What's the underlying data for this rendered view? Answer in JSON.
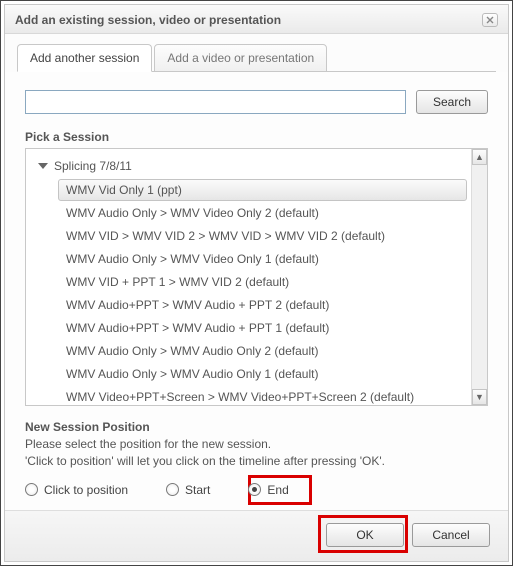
{
  "dialog": {
    "title": "Add an existing session, video or presentation"
  },
  "tabs": {
    "active": "Add another session",
    "other": "Add a video or presentation"
  },
  "search": {
    "value": "",
    "placeholder": "",
    "button": "Search"
  },
  "pick": {
    "title": "Pick a Session",
    "parent": "Splicing 7/8/11",
    "items": [
      "WMV Vid Only 1 (ppt)",
      "WMV Audio Only > WMV Video Only 2 (default)",
      "WMV VID > WMV VID 2 > WMV VID > WMV VID 2 (default)",
      "WMV Audio Only > WMV Video Only 1 (default)",
      "WMV VID + PPT 1 > WMV VID 2 (default)",
      "WMV Audio+PPT > WMV Audio + PPT 2 (default)",
      "WMV Audio+PPT > WMV Audio + PPT 1 (default)",
      "WMV Audio Only > WMV Audio Only 2 (default)",
      "WMV Audio Only > WMV Audio Only 1 (default)",
      "WMV Video+PPT+Screen > WMV Video+PPT+Screen 2 (default)"
    ],
    "selected_index": 0
  },
  "position": {
    "title": "New Session Position",
    "desc1": "Please select the position for the new session.",
    "desc2": "'Click to position' will let you click on the timeline after pressing 'OK'.",
    "options": {
      "click": "Click to position",
      "start": "Start",
      "end": "End"
    },
    "selected": "end"
  },
  "buttons": {
    "ok": "OK",
    "cancel": "Cancel"
  }
}
